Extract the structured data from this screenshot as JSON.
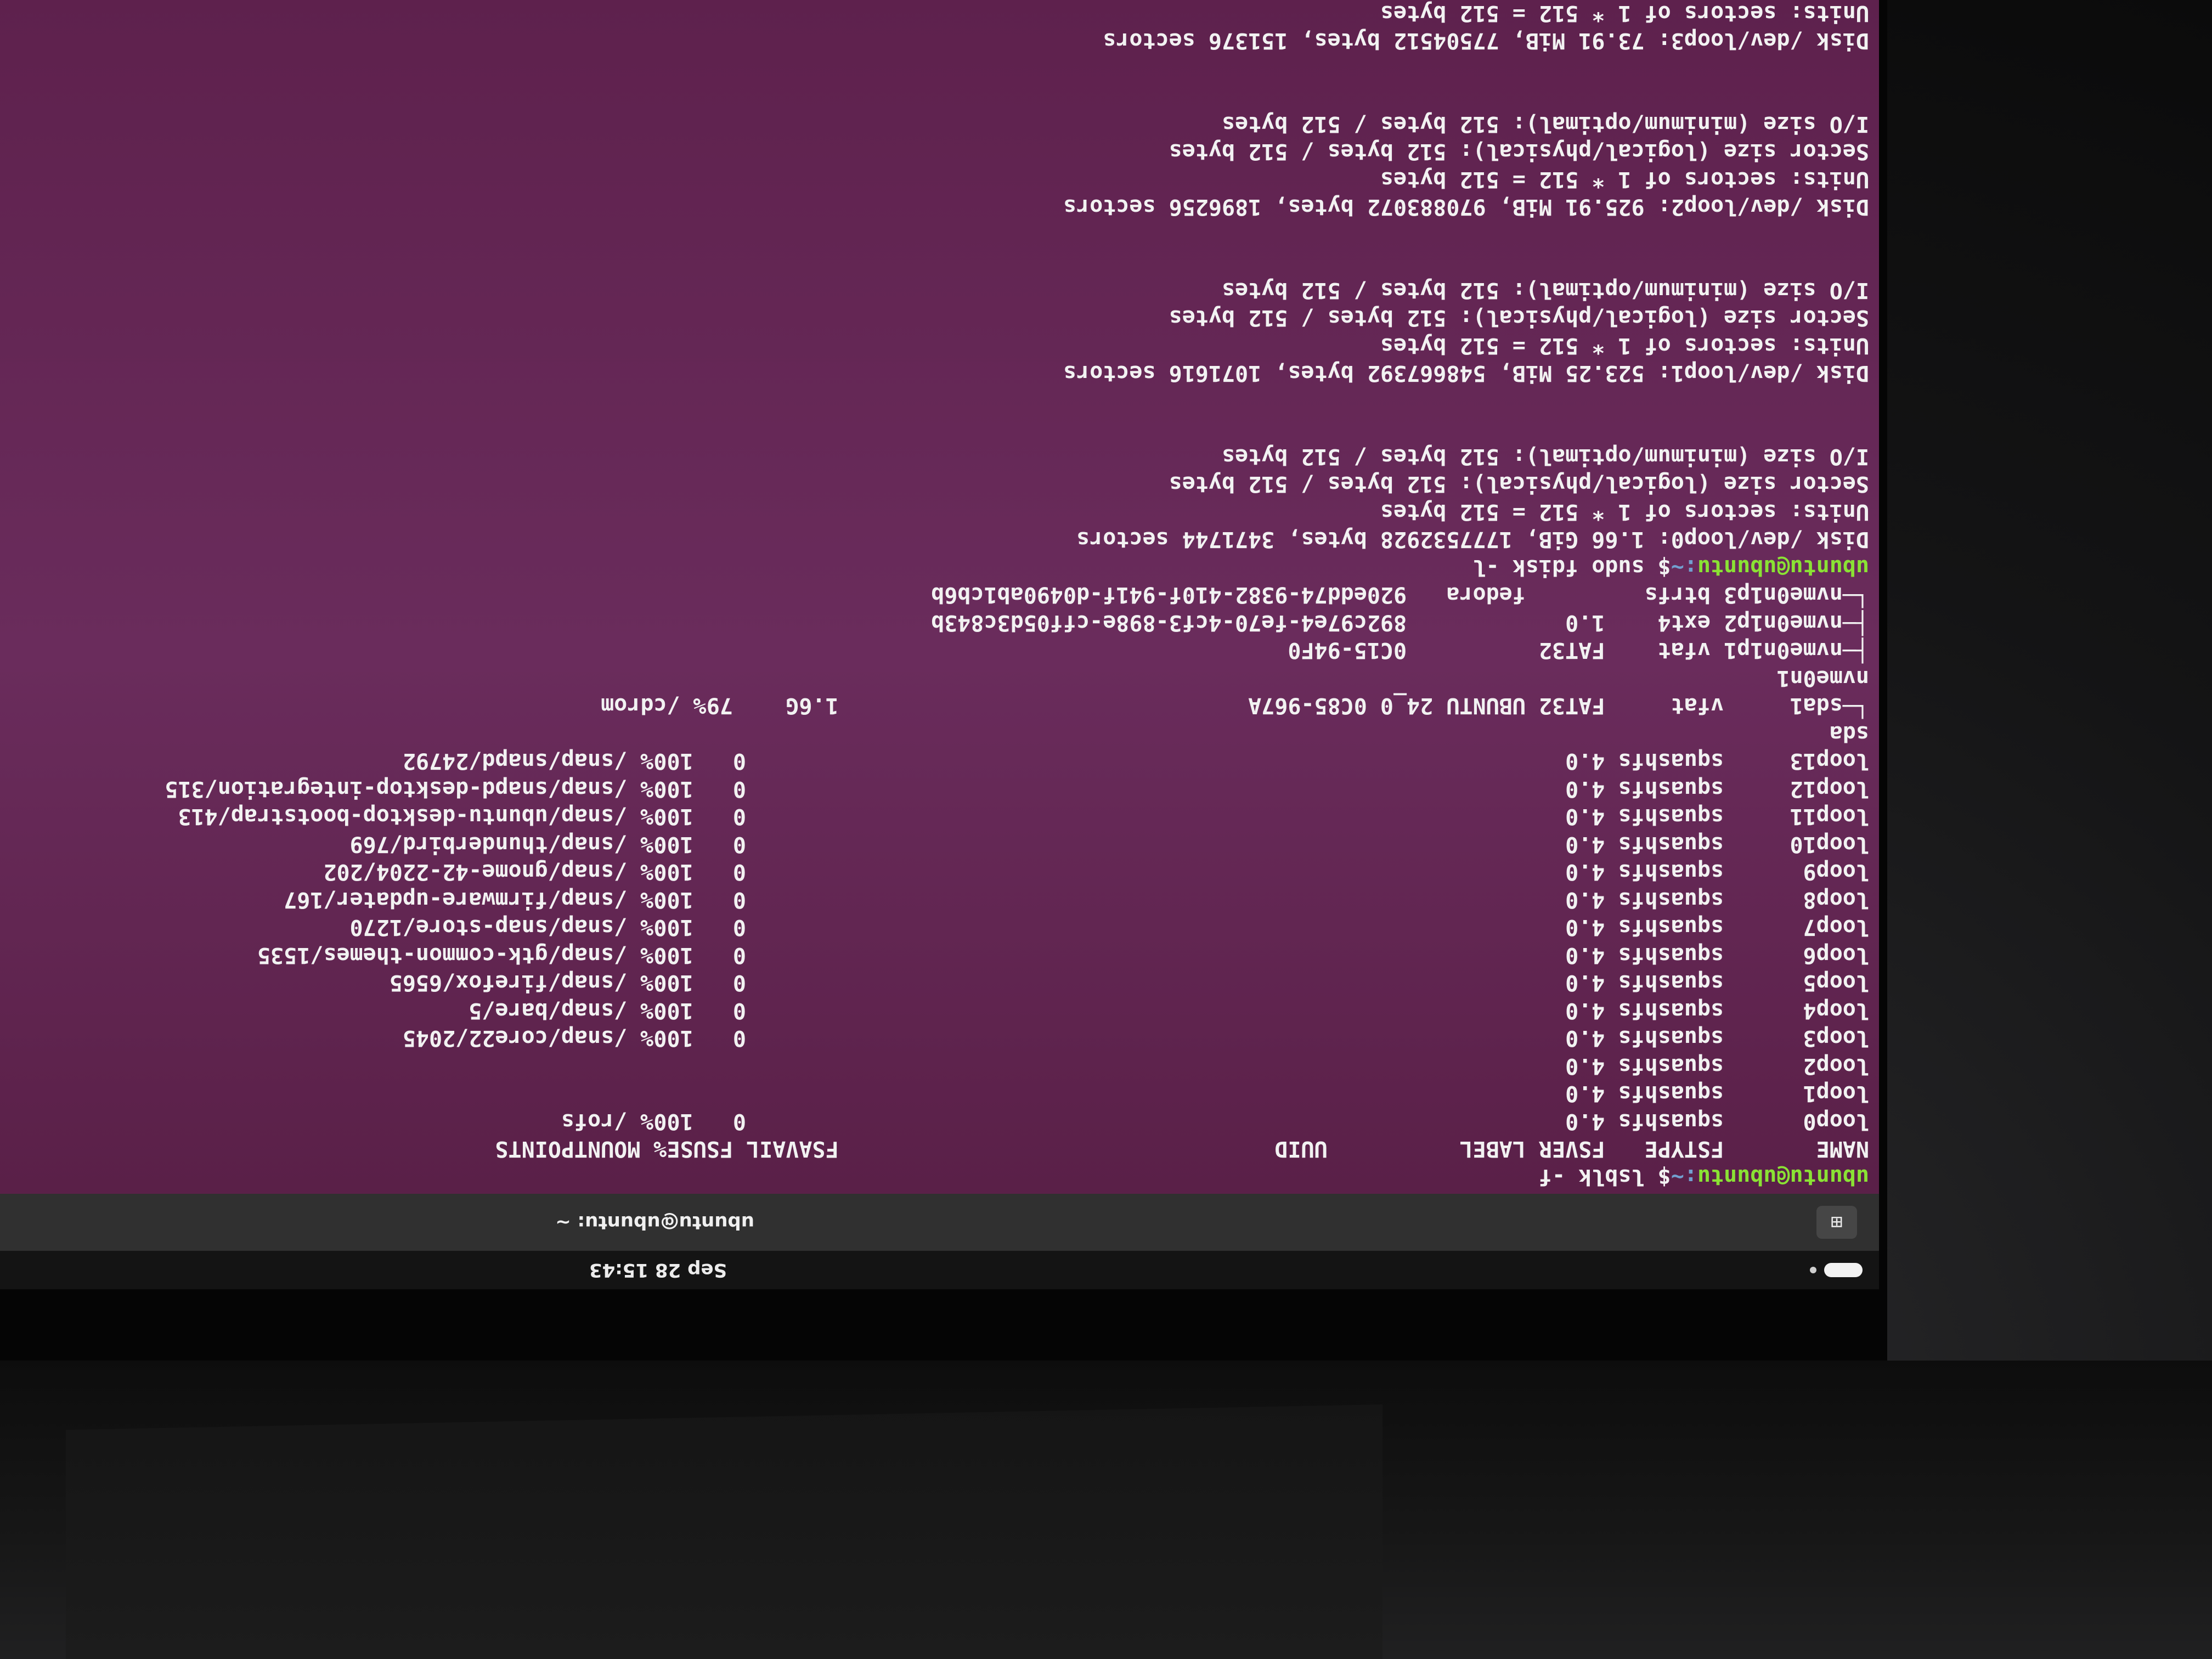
{
  "topbar": {
    "clock": "Sep 28 15:43"
  },
  "terminal": {
    "title": "ubuntu@ubuntu: ~",
    "newtab_icon": "⊞"
  },
  "lines": [
    {
      "user": "ubuntu@ubuntu",
      "path": ":~",
      "cmd": "$ lsblk -f"
    },
    {
      "text": "NAME       FSTYPE   FSVER LABEL          UUID                                 FSAVAIL FSUSE% MOUNTPOINTS"
    },
    {
      "text": "loop0      squashfs 4.0                                                              0   100% /rofs"
    },
    {
      "text": "loop1      squashfs 4.0"
    },
    {
      "text": "loop2      squashfs 4.0"
    },
    {
      "text": "loop3      squashfs 4.0                                                              0   100% /snap/core22/2045"
    },
    {
      "text": "loop4      squashfs 4.0                                                              0   100% /snap/bare/5"
    },
    {
      "text": "loop5      squashfs 4.0                                                              0   100% /snap/firefox/6565"
    },
    {
      "text": "loop6      squashfs 4.0                                                              0   100% /snap/gtk-common-themes/1535"
    },
    {
      "text": "loop7      squashfs 4.0                                                              0   100% /snap/snap-store/1270"
    },
    {
      "text": "loop8      squashfs 4.0                                                              0   100% /snap/firmware-updater/167"
    },
    {
      "text": "loop9      squashfs 4.0                                                              0   100% /snap/gnome-42-2204/202"
    },
    {
      "text": "loop10     squashfs 4.0                                                              0   100% /snap/thunderbird/769"
    },
    {
      "text": "loop11     squashfs 4.0                                                              0   100% /snap/ubuntu-desktop-bootstrap/413"
    },
    {
      "text": "loop12     squashfs 4.0                                                              0   100% /snap/snapd-desktop-integration/315"
    },
    {
      "text": "loop13     squashfs 4.0                                                              0   100% /snap/snapd/24792"
    },
    {
      "text": "sda"
    },
    {
      "text": "└─sda1     vfat     FAT32 UBUNTU 24_0 0C85-967A                               1.6G    79% /cdrom"
    },
    {
      "text": "nvme0n1"
    },
    {
      "text": "├─nvme0n1p1 vfat    FAT32          0C15-94F0"
    },
    {
      "text": "├─nvme0n1p2 ext4    1.0            892c97e4-fe70-4cf3-898e-cff05d3c843b"
    },
    {
      "text": "└─nvme0n1p3 btrfs         fedora   920edd74-9382-410f-941f-d0490ab1cb6b"
    },
    {
      "user": "ubuntu@ubuntu",
      "path": ":~",
      "cmd": "$ sudo fdisk -l"
    },
    {
      "text": "Disk /dev/loop0: 1.66 GiB, 1777532928 bytes, 3471744 sectors",
      "bold": true
    },
    {
      "text": "Units: sectors of 1 * 512 = 512 bytes"
    },
    {
      "text": "Sector size (logical/physical): 512 bytes / 512 bytes"
    },
    {
      "text": "I/O size (minimum/optimal): 512 bytes / 512 bytes"
    },
    {
      "text": ""
    },
    {
      "text": ""
    },
    {
      "text": "Disk /dev/loop1: 523.25 MiB, 548667392 bytes, 1071616 sectors",
      "bold": true
    },
    {
      "text": "Units: sectors of 1 * 512 = 512 bytes"
    },
    {
      "text": "Sector size (logical/physical): 512 bytes / 512 bytes"
    },
    {
      "text": "I/O size (minimum/optimal): 512 bytes / 512 bytes"
    },
    {
      "text": ""
    },
    {
      "text": ""
    },
    {
      "text": "Disk /dev/loop2: 925.91 MiB, 970883072 bytes, 1896256 sectors",
      "bold": true
    },
    {
      "text": "Units: sectors of 1 * 512 = 512 bytes"
    },
    {
      "text": "Sector size (logical/physical): 512 bytes / 512 bytes"
    },
    {
      "text": "I/O size (minimum/optimal): 512 bytes / 512 bytes"
    },
    {
      "text": ""
    },
    {
      "text": ""
    },
    {
      "text": "Disk /dev/loop3: 73.91 MiB, 77504512 bytes, 151376 sectors",
      "bold": true
    },
    {
      "text": "Units: sectors of 1 * 512 = 512 bytes"
    }
  ]
}
